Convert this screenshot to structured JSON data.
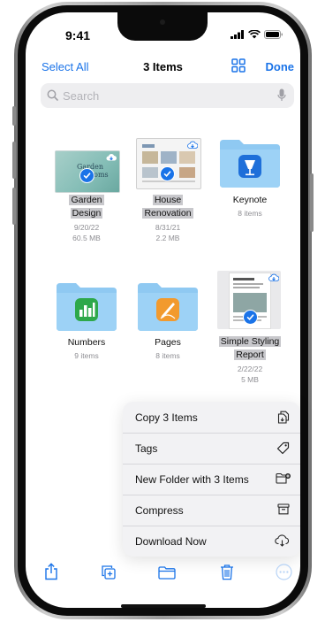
{
  "status": {
    "time": "9:41"
  },
  "nav": {
    "select_all": "Select All",
    "title": "3 Items",
    "done": "Done"
  },
  "search": {
    "placeholder": "Search"
  },
  "items": [
    {
      "name_lines": [
        "Garden",
        "Design"
      ],
      "date": "9/20/22",
      "size": "60.5 MB",
      "selected": true
    },
    {
      "name_lines": [
        "House",
        "Renovation"
      ],
      "date": "8/31/21",
      "size": "2.2 MB",
      "selected": true
    },
    {
      "name_lines": [
        "Keynote"
      ],
      "count": "8 items",
      "selected": false
    },
    {
      "name_lines": [
        "Numbers"
      ],
      "count": "9 items",
      "selected": false
    },
    {
      "name_lines": [
        "Pages"
      ],
      "count": "8 items",
      "selected": false
    },
    {
      "name_lines": [
        "Simple Styling",
        "Report"
      ],
      "date": "2/22/22",
      "size": "5 MB",
      "selected": true
    }
  ],
  "thumbnail_text": {
    "garden_line1": "Garden",
    "garden_line2": "Rooms"
  },
  "context_menu": [
    {
      "label": "Copy 3 Items",
      "icon": "copy-doc-icon"
    },
    {
      "label": "Tags",
      "icon": "tag-icon"
    },
    {
      "label": "New Folder with 3 Items",
      "icon": "new-folder-icon"
    },
    {
      "label": "Compress",
      "icon": "archive-box-icon"
    },
    {
      "label": "Download Now",
      "icon": "cloud-download-icon"
    }
  ],
  "toolbar": [
    "share-icon",
    "duplicate-icon",
    "move-folder-icon",
    "trash-icon",
    "more-icon"
  ],
  "colors": {
    "accent": "#1a73e8",
    "folder": "#8fc9f2",
    "menu_bg": "#f2f2f4"
  }
}
